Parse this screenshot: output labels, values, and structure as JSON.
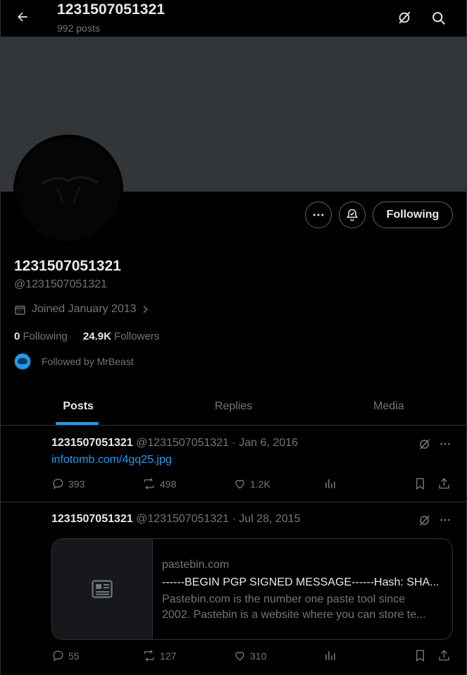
{
  "header": {
    "title": "1231507051321",
    "post_count": "992 posts",
    "back_icon": "arrow-left-icon",
    "grok_icon": "grok-icon",
    "search_icon": "search-icon"
  },
  "profile": {
    "name": "1231507051321",
    "handle": "@1231507051321",
    "joined": "Joined January 2013",
    "following_count": "0",
    "following_label": "Following",
    "followers_count": "24.9K",
    "followers_label": "Followers",
    "followed_by": "Followed by MrBeast",
    "follow_button": "Following"
  },
  "tabs": [
    {
      "label": "Posts",
      "active": true
    },
    {
      "label": "Replies",
      "active": false
    },
    {
      "label": "Media",
      "active": false
    }
  ],
  "posts": [
    {
      "name": "1231507051321",
      "meta": "@1231507051321 · Jan 6, 2016",
      "link": "infotomb.com/4gq25.jpg",
      "replies": "393",
      "reposts": "498",
      "likes": "1.2K"
    },
    {
      "name": "1231507051321",
      "meta": "@1231507051321 · Jul 28, 2015",
      "card": {
        "domain": "pastebin.com",
        "title": "------BEGIN PGP SIGNED MESSAGE------Hash: SHA...",
        "desc_line1": "Pastebin.com is the number one paste tool since",
        "desc_line2": "2002. Pastebin is a website where you can store te..."
      },
      "replies": "55",
      "reposts": "127",
      "likes": "310"
    }
  ],
  "colors": {
    "accent": "#1d9bf0",
    "text": "#e7e9ea",
    "muted": "#71767b",
    "border": "#2f3336",
    "banner": "#333639"
  }
}
